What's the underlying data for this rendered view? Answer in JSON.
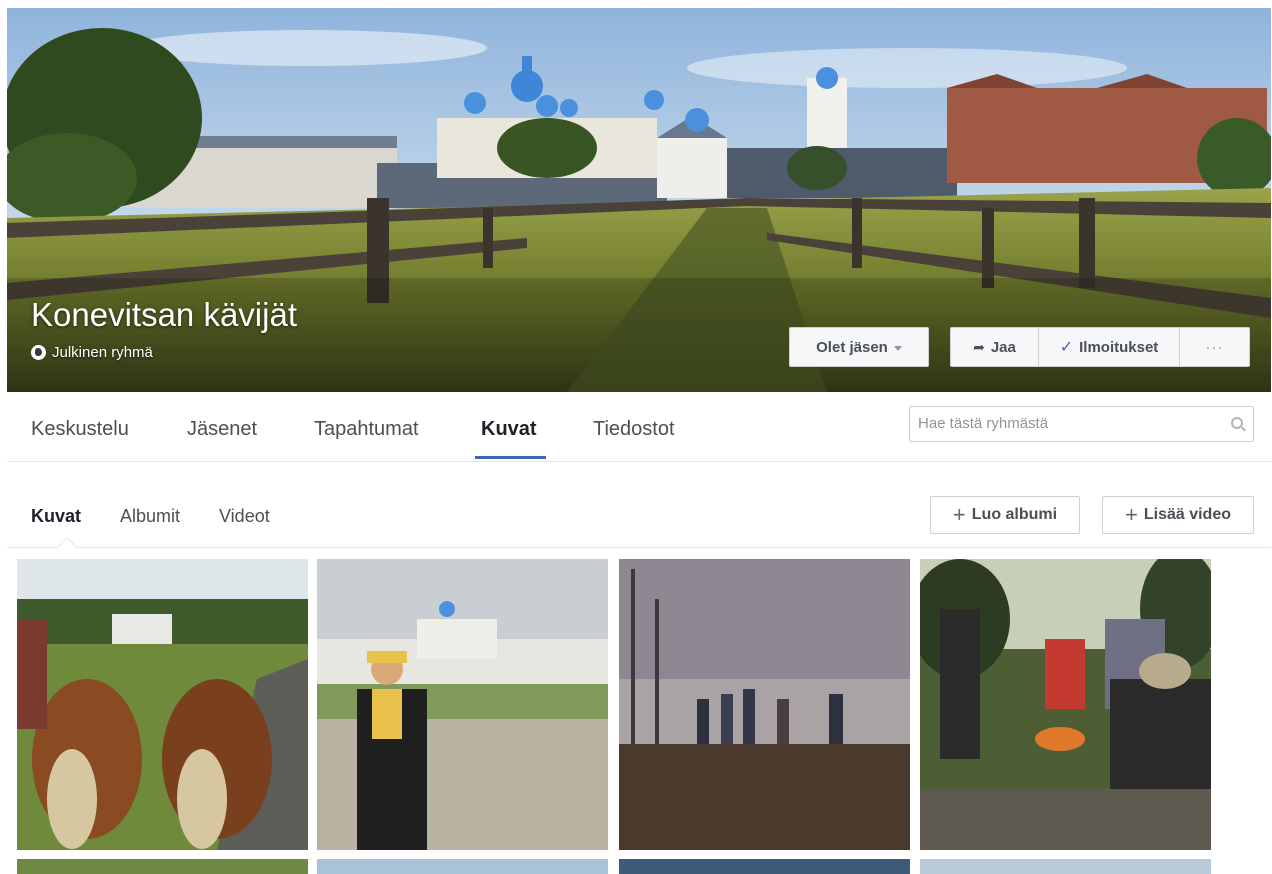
{
  "group": {
    "name": "Konevitsan kävijät",
    "privacy": "Julkinen ryhmä"
  },
  "cover_actions": {
    "member": "Olet jäsen",
    "share": "Jaa",
    "notifications": "Ilmoitukset",
    "more": "···"
  },
  "tabs": [
    {
      "label": "Keskustelu",
      "active": false
    },
    {
      "label": "Jäsenet",
      "active": false
    },
    {
      "label": "Tapahtumat",
      "active": false
    },
    {
      "label": "Kuvat",
      "active": true
    },
    {
      "label": "Tiedostot",
      "active": false
    }
  ],
  "search": {
    "placeholder": "Hae tästä ryhmästä"
  },
  "subtabs": [
    {
      "label": "Kuvat",
      "active": true
    },
    {
      "label": "Albumit",
      "active": false
    },
    {
      "label": "Videot",
      "active": false
    }
  ],
  "actions": {
    "create_album": "Luo albumi",
    "add_video": "Lisää video"
  },
  "colors": {
    "accent": "#4267b2",
    "button_bg": "#f6f7f9",
    "border": "#ced0d4"
  }
}
